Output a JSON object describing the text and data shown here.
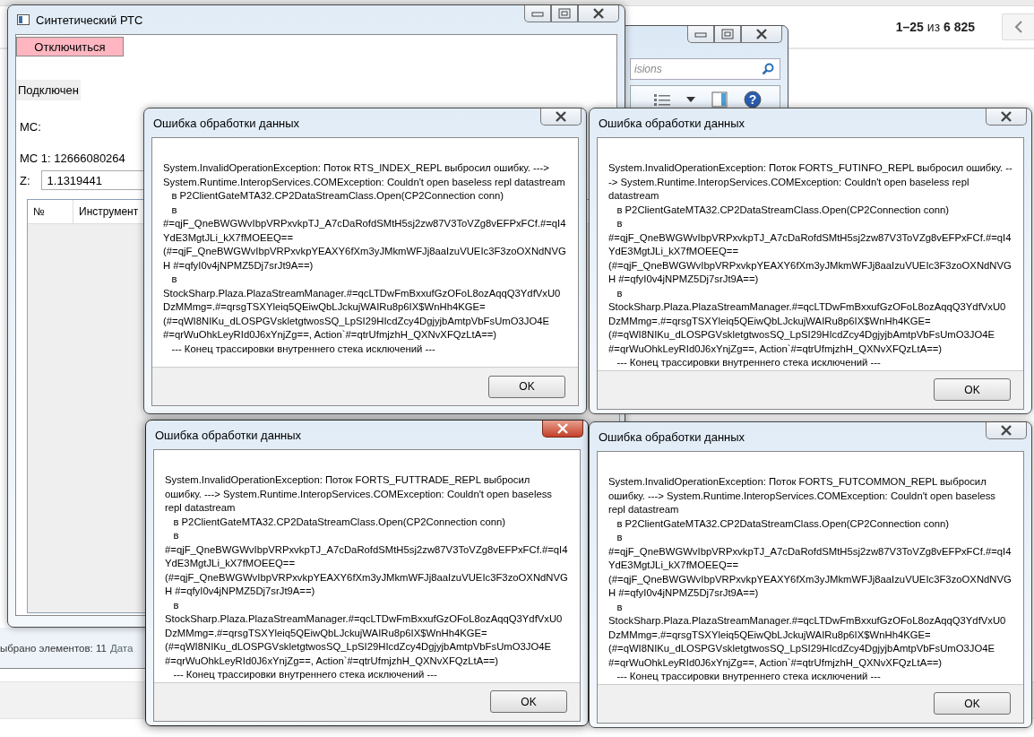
{
  "background_page": {
    "pager": "**1–25** из **6 825**"
  },
  "explorer": {
    "search_placeholder": "isions",
    "help_glyph": "?",
    "status": "ыбрано элементов: 11",
    "status_extra": "Дата"
  },
  "main_window": {
    "title": "Синтетический РТС",
    "disconnect_button": "Отключиться",
    "status": "Подключен",
    "ms_label": "МС:",
    "ms1": "МС 1: 12666080264",
    "z_label": "Z:",
    "z_value": "1.1319441",
    "columns": [
      "№",
      "Инструмент"
    ]
  },
  "dialogs": [
    {
      "title": "Ошибка обработки данных",
      "active": false,
      "button": "OK",
      "message": "System.InvalidOperationException: Поток RTS_INDEX_REPL выбросил ошибку. ---> System.Runtime.InteropServices.COMException: Couldn't open baseless repl datastream\n   в P2ClientGateMTA32.CP2DataStreamClass.Open(CP2Connection conn)\n   в #=qjF_QneBWGWvIbpVRPxvkpTJ_A7cDaRofdSMtH5sj2zw87V3ToVZg8vEFPxFCf.#=qI4YdE3MgtJLi_kX7fMOEEQ==(#=qjF_QneBWGWvIbpVRPxvkpYEAXY6fXm3yJMkmWFJj8aaIzuVUEIc3F3zoOXNdNVGH #=qfyI0v4jNPMZ5Dj7srJt9A==)\n   в StockSharp.Plaza.PlazaStreamManager.#=qcLTDwFmBxxufGzOFoL8ozAqqQ3YdfVxU0DzMMmg=.#=qrsgTSXYleiq5QEiwQbLJckujWAIRu8p6IX$WnHh4KGE=(#=qWI8NIKu_dLOSPGVskletgtwosSQ_LpSI29HIcdZcy4DgjyjbAmtpVbFsUmO3JO4E #=qrWuOhkLeyRId0J6xYnjZg==, Action`#=qtrUfmjzhH_QXNvXFQzLtA==)\n   --- Конец трассировки внутреннего стека исключений ---"
    },
    {
      "title": "Ошибка обработки данных",
      "active": false,
      "button": "OK",
      "message": "System.InvalidOperationException: Поток FORTS_FUTINFO_REPL выбросил ошибку. ---> System.Runtime.InteropServices.COMException: Couldn't open baseless repl datastream\n   в P2ClientGateMTA32.CP2DataStreamClass.Open(CP2Connection conn)\n   в #=qjF_QneBWGWvIbpVRPxvkpTJ_A7cDaRofdSMtH5sj2zw87V3ToVZg8vEFPxFCf.#=qI4YdE3MgtJLi_kX7fMOEEQ==(#=qjF_QneBWGWvIbpVRPxvkpYEAXY6fXm3yJMkmWFJj8aaIzuVUEIc3F3zoOXNdNVGH #=qfyI0v4jNPMZ5Dj7srJt9A==)\n   в StockSharp.Plaza.PlazaStreamManager.#=qcLTDwFmBxxufGzOFoL8ozAqqQ3YdfVxU0DzMMmg=.#=qrsgTSXYleiq5QEiwQbLJckujWAIRu8p6IX$WnHh4KGE=(#=qWI8NIKu_dLOSPGVskletgtwosSQ_LpSI29HIcdZcy4DgjyjbAmtpVbFsUmO3JO4E #=qrWuOhkLeyRId0J6xYnjZg==, Action`#=qtrUfmjzhH_QXNvXFQzLtA==)\n   --- Конец трассировки внутреннего стека исключений ---"
    },
    {
      "title": "Ошибка обработки данных",
      "active": true,
      "button": "OK",
      "message": "System.InvalidOperationException: Поток FORTS_FUTTRADE_REPL выбросил ошибку. ---> System.Runtime.InteropServices.COMException: Couldn't open baseless repl datastream\n   в P2ClientGateMTA32.CP2DataStreamClass.Open(CP2Connection conn)\n   в #=qjF_QneBWGWvIbpVRPxvkpTJ_A7cDaRofdSMtH5sj2zw87V3ToVZg8vEFPxFCf.#=qI4YdE3MgtJLi_kX7fMOEEQ==(#=qjF_QneBWGWvIbpVRPxvkpYEAXY6fXm3yJMkmWFJj8aaIzuVUEIc3F3zoOXNdNVGH #=qfyI0v4jNPMZ5Dj7srJt9A==)\n   в StockSharp.Plaza.PlazaStreamManager.#=qcLTDwFmBxxufGzOFoL8ozAqqQ3YdfVxU0DzMMmg=.#=qrsgTSXYleiq5QEiwQbLJckujWAIRu8p6IX$WnHh4KGE=(#=qWI8NIKu_dLOSPGVskletgtwosSQ_LpSI29HIcdZcy4DgjyjbAmtpVbFsUmO3JO4E #=qrWuOhkLeyRId0J6xYnjZg==, Action`#=qtrUfmjzhH_QXNvXFQzLtA==)\n   --- Конец трассировки внутреннего стека исключений ---"
    },
    {
      "title": "Ошибка обработки данных",
      "active": false,
      "button": "OK",
      "message": "System.InvalidOperationException: Поток FORTS_FUTCOMMON_REPL выбросил ошибку. ---> System.Runtime.InteropServices.COMException: Couldn't open baseless repl datastream\n   в P2ClientGateMTA32.CP2DataStreamClass.Open(CP2Connection conn)\n   в #=qjF_QneBWGWvIbpVRPxvkpTJ_A7cDaRofdSMtH5sj2zw87V3ToVZg8vEFPxFCf.#=qI4YdE3MgtJLi_kX7fMOEEQ==(#=qjF_QneBWGWvIbpVRPxvkpYEAXY6fXm3yJMkmWFJj8aaIzuVUEIc3F3zoOXNdNVGH #=qfyI0v4jNPMZ5Dj7srJt9A==)\n   в StockSharp.Plaza.PlazaStreamManager.#=qcLTDwFmBxxufGzOFoL8ozAqqQ3YdfVxU0DzMMmg=.#=qrsgTSXYleiq5QEiwQbLJckujWAIRu8p6IX$WnHh4KGE=(#=qWI8NIKu_dLOSPGVskletgtwosSQ_LpSI29HIcdZcy4DgjyjbAmtpVbFsUmO3JO4E #=qrWuOhkLeyRId0J6xYnjZg==, Action`#=qtrUfmjzhH_QXNvXFQzLtA==)\n   --- Конец трассировки внутреннего стека исключений ---"
    }
  ]
}
